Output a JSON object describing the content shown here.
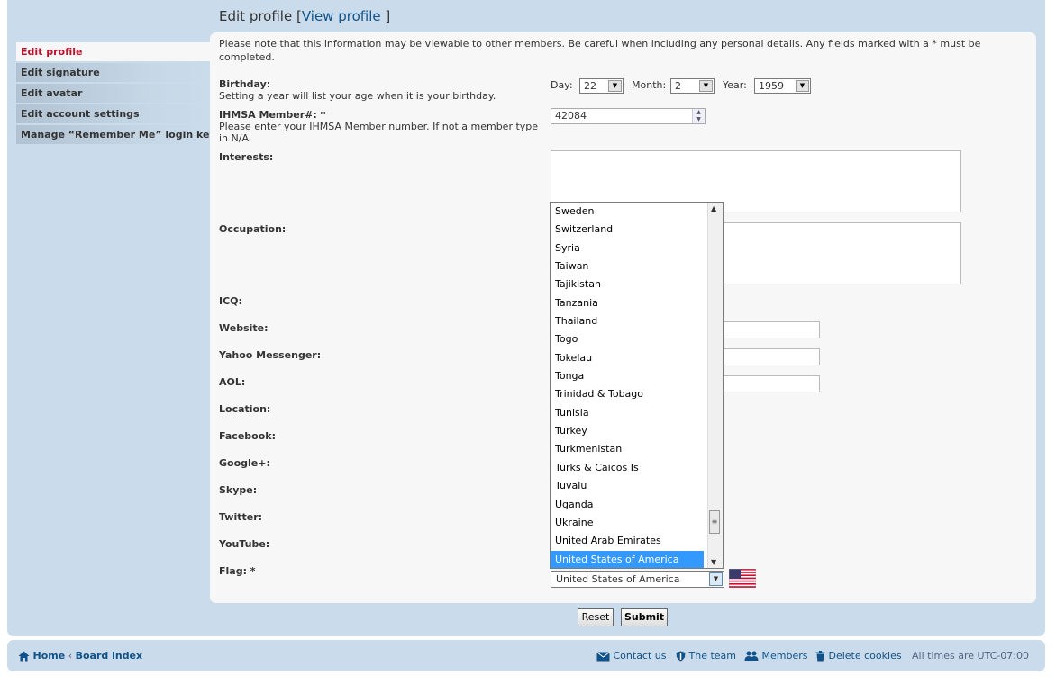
{
  "page": {
    "title": "Edit profile",
    "view_profile": "View profile",
    "bracket_open": "[",
    "bracket_close": "]"
  },
  "sidebar": {
    "items": [
      {
        "label": "Edit profile",
        "active": true
      },
      {
        "label": "Edit signature"
      },
      {
        "label": "Edit avatar"
      },
      {
        "label": "Edit account settings"
      },
      {
        "label": "Manage “Remember Me” login keys"
      }
    ]
  },
  "note": "Please note that this information may be viewable to other members. Be careful when including any personal details. Any fields marked with a * must be completed.",
  "birthday": {
    "label": "Birthday:",
    "help": "Setting a year will list your age when it is your birthday.",
    "day_label": "Day:",
    "day_value": "22",
    "month_label": "Month:",
    "month_value": "2",
    "year_label": "Year:",
    "year_value": "1959"
  },
  "member": {
    "label": "IHMSA Member#: *",
    "help": "Please enter your IHMSA Member number. If not a member type in N/A.",
    "value": "42084"
  },
  "fields": {
    "interests": "Interests:",
    "occupation": "Occupation:",
    "icq": "ICQ:",
    "website": "Website:",
    "yahoo": "Yahoo Messenger:",
    "aol": "AOL:",
    "location": "Location:",
    "facebook": "Facebook:",
    "google": "Google+:",
    "skype": "Skype:",
    "twitter": "Twitter:",
    "youtube": "YouTube:",
    "flag": "Flag: *"
  },
  "flag_dropdown": {
    "options": [
      "Sweden",
      "Switzerland",
      "Syria",
      "Taiwan",
      "Tajikistan",
      "Tanzania",
      "Thailand",
      "Togo",
      "Tokelau",
      "Tonga",
      "Trinidad & Tobago",
      "Tunisia",
      "Turkey",
      "Turkmenistan",
      "Turks & Caicos Is",
      "Tuvalu",
      "Uganda",
      "Ukraine",
      "United Arab Emirates",
      "United States of America"
    ],
    "selected": "United States of America"
  },
  "buttons": {
    "reset": "Reset",
    "submit": "Submit"
  },
  "footer": {
    "home": "Home",
    "board_index": "Board index",
    "contact": "Contact us",
    "team": "The team",
    "members": "Members",
    "delete_cookies": "Delete cookies",
    "timezone": "All times are UTC-07:00"
  },
  "colors": {
    "panel": "#cadceb",
    "link": "#105289",
    "active_tab": "#c0102b",
    "highlight": "#3399ff"
  }
}
